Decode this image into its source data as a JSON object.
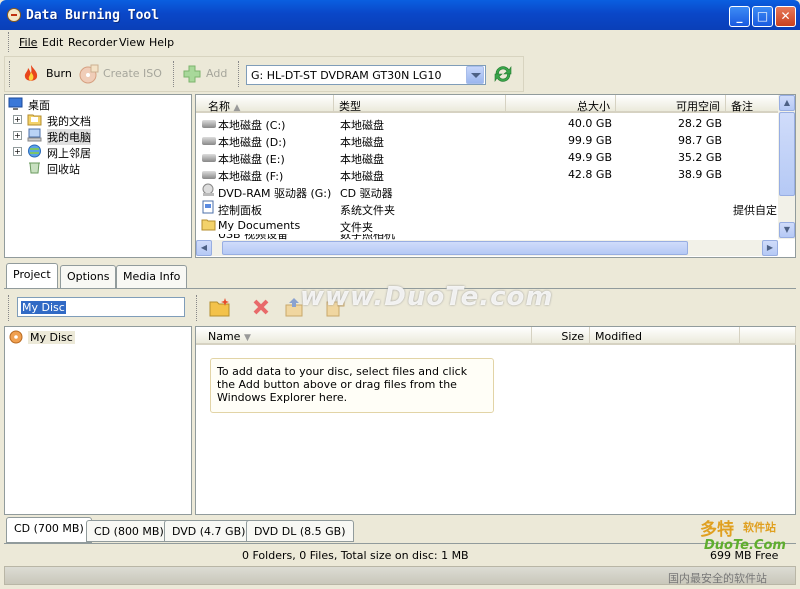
{
  "window": {
    "title": "Data Burning Tool",
    "minimize": "_",
    "maximize": "□",
    "close": "✕"
  },
  "menu": [
    "File",
    "Edit",
    "Recorder",
    "View",
    "Help"
  ],
  "toolbar": {
    "burn": "Burn",
    "create_iso": "Create ISO",
    "add": "Add",
    "drive": "G: HL-DT-ST DVDRAM GT30N LG10"
  },
  "tree": [
    "桌面",
    "我的文档",
    "我的电脑",
    "网上邻居",
    "回收站"
  ],
  "filelist": {
    "headers": [
      "名称",
      "类型",
      "总大小",
      "可用空间",
      "备注"
    ],
    "rows": [
      {
        "name": "本地磁盘 (C:)",
        "type": "本地磁盘",
        "total": "40.0 GB",
        "free": "28.2 GB",
        "note": ""
      },
      {
        "name": "本地磁盘 (D:)",
        "type": "本地磁盘",
        "total": "99.9 GB",
        "free": "98.7 GB",
        "note": ""
      },
      {
        "name": "本地磁盘 (E:)",
        "type": "本地磁盘",
        "total": "49.9 GB",
        "free": "35.2 GB",
        "note": ""
      },
      {
        "name": "本地磁盘 (F:)",
        "type": "本地磁盘",
        "total": "42.8 GB",
        "free": "38.9 GB",
        "note": ""
      },
      {
        "name": "DVD-RAM 驱动器 (G:)",
        "type": "CD 驱动器",
        "total": "",
        "free": "",
        "note": ""
      },
      {
        "name": "控制面板",
        "type": "系统文件夹",
        "total": "",
        "free": "",
        "note": "提供自定"
      },
      {
        "name": "My Documents",
        "type": "文件夹",
        "total": "",
        "free": "",
        "note": ""
      },
      {
        "name": "USB 视频设备",
        "type": "数字照相机",
        "total": "",
        "free": "",
        "note": ""
      }
    ]
  },
  "tabs": [
    "Project",
    "Options",
    "Media Info"
  ],
  "project": {
    "disc_name": "My Disc",
    "tree_item": "My Disc"
  },
  "plist": {
    "headers": [
      "Name",
      "Size",
      "Modified"
    ],
    "hint": "To add data to your disc, select files and click the Add button above or drag files from the Windows Explorer here."
  },
  "disc_tabs": [
    "CD (700 MB)",
    "CD (800 MB)",
    "DVD (4.7 GB)",
    "DVD DL (8.5 GB)"
  ],
  "status": {
    "summary": "0 Folders, 0 Files, Total size on disc: 1 MB",
    "free": "699 MB Free"
  },
  "watermarks": {
    "main": "www.DuoTe.com",
    "logo": "多特",
    "logo_sub": "软件站",
    "url": "DuoTe.Com",
    "slogan": "国内最安全的软件站"
  }
}
